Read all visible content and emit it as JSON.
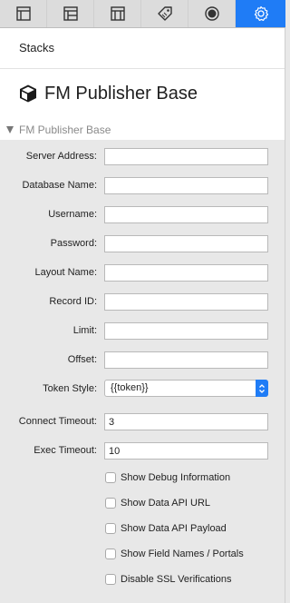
{
  "toolbar": {
    "tabs": [
      {
        "icon": "layout-icon"
      },
      {
        "icon": "layout-split-icon"
      },
      {
        "icon": "layout-columns-icon"
      },
      {
        "icon": "tag-icon"
      },
      {
        "icon": "circle-target-icon"
      },
      {
        "icon": "gear-icon"
      }
    ],
    "active_index": 5,
    "active_color": "#1f7cf6"
  },
  "header": {
    "stacks_label": "Stacks",
    "plugin_title": "FM Publisher Base"
  },
  "section": {
    "title": "FM Publisher Base"
  },
  "form": {
    "server_address": {
      "label": "Server Address:",
      "value": ""
    },
    "database_name": {
      "label": "Database Name:",
      "value": ""
    },
    "username": {
      "label": "Username:",
      "value": ""
    },
    "password": {
      "label": "Password:",
      "value": ""
    },
    "layout_name": {
      "label": "Layout Name:",
      "value": ""
    },
    "record_id": {
      "label": "Record ID:",
      "value": ""
    },
    "limit": {
      "label": "Limit:",
      "value": ""
    },
    "offset": {
      "label": "Offset:",
      "value": ""
    },
    "token_style": {
      "label": "Token Style:",
      "value": "{{token}}"
    },
    "connect_timeout": {
      "label": "Connect Timeout:",
      "value": "3"
    },
    "exec_timeout": {
      "label": "Exec Timeout:",
      "value": "10"
    }
  },
  "checkboxes": [
    {
      "label": "Show Debug Information",
      "checked": false
    },
    {
      "label": "Show Data API URL",
      "checked": false
    },
    {
      "label": "Show Data API Payload",
      "checked": false
    },
    {
      "label": "Show Field Names / Portals",
      "checked": false
    },
    {
      "label": "Disable SSL Verifications",
      "checked": false
    }
  ]
}
